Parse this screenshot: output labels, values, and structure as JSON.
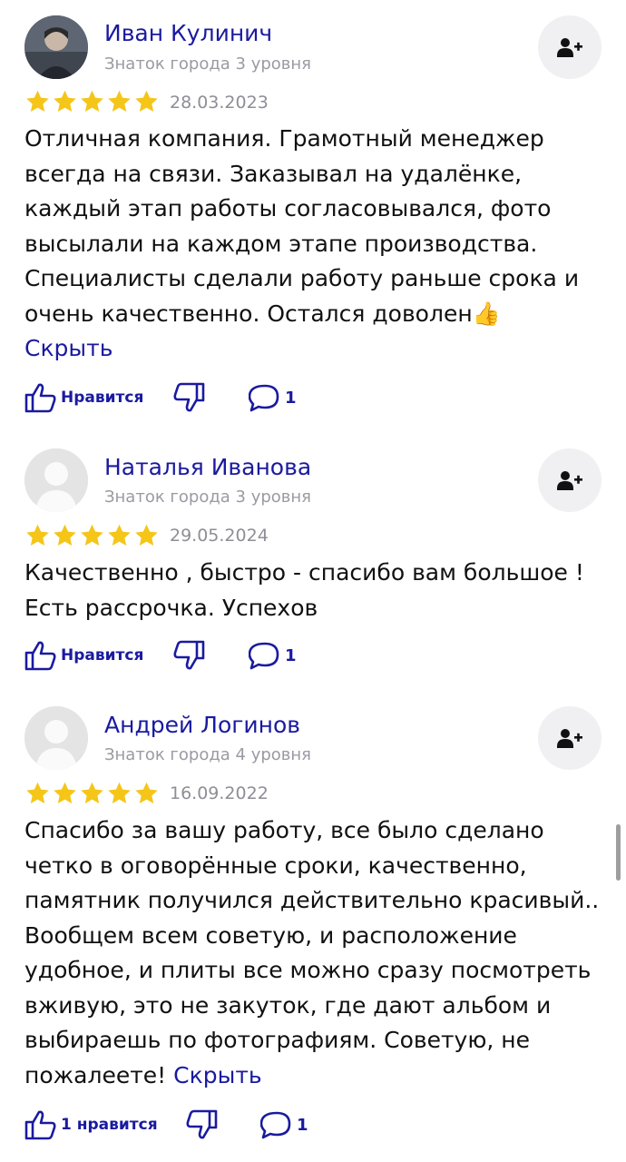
{
  "reviews": [
    {
      "author": "Иван Кулинич",
      "level": "Знаток города 3 уровня",
      "rating": 5,
      "date": "28.03.2023",
      "text": "Отличная компания. Грамотный менеджер всегда на связи. Заказывал на удалёнке, каждый этап работы согласовывался, фото высылали на каждом этапе производства. Специалисты сделали работу раньше срока и очень качественно. Остался доволен",
      "emoji": "👍",
      "hide_label": "Скрыть",
      "like_label": "Нравится",
      "comments": "1",
      "avatar": "photo"
    },
    {
      "author": "Наталья Иванова",
      "level": "Знаток города 3 уровня",
      "rating": 5,
      "date": "29.05.2024",
      "text": "Качественно , быстро - спасибо вам большое ! Есть рассрочка. Успехов",
      "like_label": "Нравится",
      "comments": "1",
      "avatar": "placeholder"
    },
    {
      "author": "Андрей Логинов",
      "level": "Знаток города 4 уровня",
      "rating": 5,
      "date": "16.09.2022",
      "text": "Спасибо за вашу работу, все было сделано четко в оговорённые сроки, качественно, памятник получился действительно красивый.. Вообщем всем советую, и расположение удобное, и плиты все можно сразу посмотреть вживую, это не закуток, где дают альбом и выбираешь по фотографиям. Советую, не пожалеете!",
      "hide_label": "Скрыть",
      "like_label": "1 нравится",
      "comments": "1",
      "avatar": "placeholder"
    }
  ],
  "colors": {
    "accent": "#1a1aa0",
    "star": "#f5c518",
    "muted": "#9a9aa2",
    "button_bg": "#f0f0f2"
  },
  "icons": [
    "subscribe-person-plus-icon",
    "star-icon",
    "thumbs-up-icon",
    "thumbs-down-icon",
    "comment-icon"
  ]
}
